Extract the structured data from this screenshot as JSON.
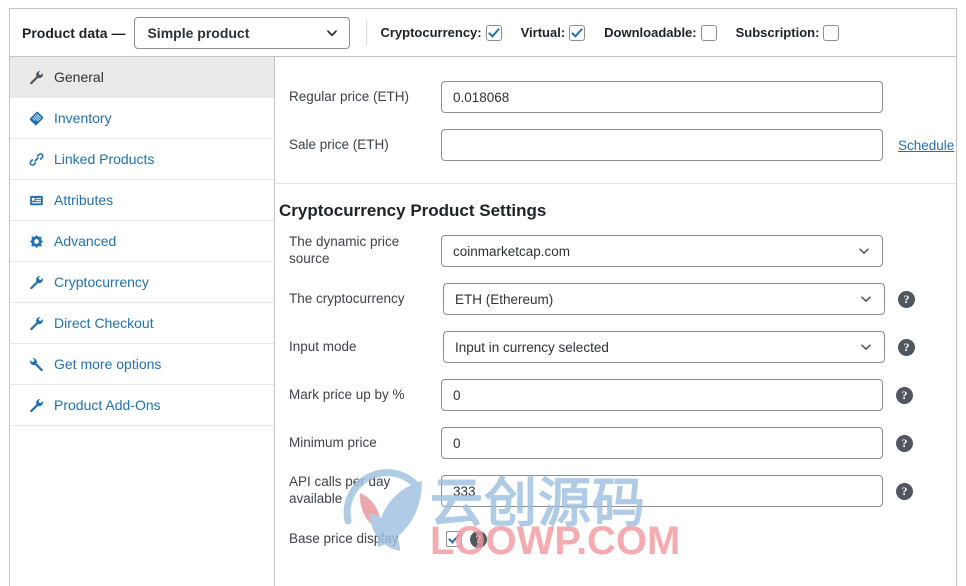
{
  "header": {
    "title": "Product data —",
    "product_type": "Simple product",
    "chevron_icon": "chevron-down-icon",
    "checkboxes": [
      {
        "label": "Cryptocurrency:",
        "checked": true
      },
      {
        "label": "Virtual:",
        "checked": true
      },
      {
        "label": "Downloadable:",
        "checked": false
      },
      {
        "label": "Subscription:",
        "checked": false
      }
    ]
  },
  "sidebar": {
    "items": [
      {
        "label": "General",
        "icon": "wrench-icon",
        "active": true
      },
      {
        "label": "Inventory",
        "icon": "tag-icon",
        "active": false
      },
      {
        "label": "Linked Products",
        "icon": "link-icon",
        "active": false
      },
      {
        "label": "Attributes",
        "icon": "list-box-icon",
        "active": false
      },
      {
        "label": "Advanced",
        "icon": "gear-icon",
        "active": false
      },
      {
        "label": "Cryptocurrency",
        "icon": "wrench-icon",
        "active": false
      },
      {
        "label": "Direct Checkout",
        "icon": "wrench-icon",
        "active": false
      },
      {
        "label": "Get more options",
        "icon": "wrench-icon",
        "active": false
      },
      {
        "label": "Product Add-Ons",
        "icon": "wrench-icon",
        "active": false
      }
    ]
  },
  "general": {
    "regular_price": {
      "label": "Regular price (ETH)",
      "value": "0.018068",
      "placeholder": ""
    },
    "sale_price": {
      "label": "Sale price (ETH)",
      "value": "",
      "placeholder": ""
    },
    "schedule_link": "Schedule"
  },
  "crypto": {
    "heading": "Cryptocurrency Product Settings",
    "help_icon": "help-icon",
    "chevron_icon": "chevron-down-icon",
    "fields": [
      {
        "label": "The dynamic price source",
        "value": "coinmarketcap.com",
        "type": "select",
        "help": false
      },
      {
        "label": "The cryptocurrency",
        "value": "ETH (Ethereum)",
        "type": "select",
        "help": true
      },
      {
        "label": "Input mode",
        "value": "Input in currency selected",
        "type": "select",
        "help": true
      },
      {
        "label": "Mark price up by %",
        "value": "0",
        "type": "text",
        "help": true
      },
      {
        "label": "Minimum price",
        "value": "0",
        "type": "text",
        "help": true
      },
      {
        "label": "API calls per day available",
        "value": "333",
        "type": "text",
        "help": true
      },
      {
        "label": "Base price display",
        "value": "",
        "type": "checkbox",
        "checked": true,
        "help": true
      }
    ]
  },
  "watermark": {
    "cn_text": "云创源码",
    "en_text": "LOOWP.COM",
    "logo_icon": "leaf-logo-icon",
    "cn_color": "#9fc0e0",
    "en_color": "#f29aa0"
  },
  "colors": {
    "link": "#2271b1",
    "border": "#c3c4c7",
    "text": "#1d2327",
    "active_tab_bg": "#eaeaea"
  }
}
